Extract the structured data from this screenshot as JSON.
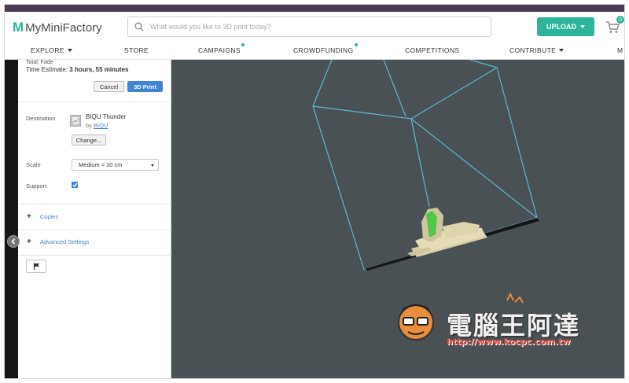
{
  "header": {
    "logo_mark": "M",
    "logo_text": "MyMiniFactory",
    "search_placeholder": "What would you like to 3D print today?",
    "upload_label": "UPLOAD",
    "cart_count": "0"
  },
  "nav": {
    "items": [
      {
        "label": "EXPLORE"
      },
      {
        "label": "STORE"
      },
      {
        "label": "CAMPAIGNS"
      },
      {
        "label": "CROWDFUNDING"
      },
      {
        "label": "COMPETITIONS"
      },
      {
        "label": "CONTRIBUTE"
      },
      {
        "label": "M"
      }
    ]
  },
  "panel": {
    "partial_text": "Total: Fade",
    "time_label": "Time Estimate:",
    "time_value": "3 hours, 55 minutes",
    "cancel_label": "Cancel",
    "print_label": "3D Print",
    "destination_label": "Destination",
    "printer_name": "BIQU Thunder",
    "printer_by": "by",
    "printer_owner": "BIQU",
    "change_label": "Change...",
    "scale_label": "Scale",
    "scale_value": "Medium ≈ 10 cm",
    "support_label": "Support",
    "support_checked": true,
    "copies_label": "Copies",
    "advanced_label": "Advanced Settings"
  },
  "watermark": {
    "text": "電腦王阿達",
    "url": "http://www.kocpc.com.tw"
  },
  "colors": {
    "brand_green": "#2cb59a",
    "link_blue": "#3f84d3",
    "viewport_bg": "#4a5154",
    "build_box": "#5bb8d6",
    "top_bar": "#4a3b57"
  }
}
